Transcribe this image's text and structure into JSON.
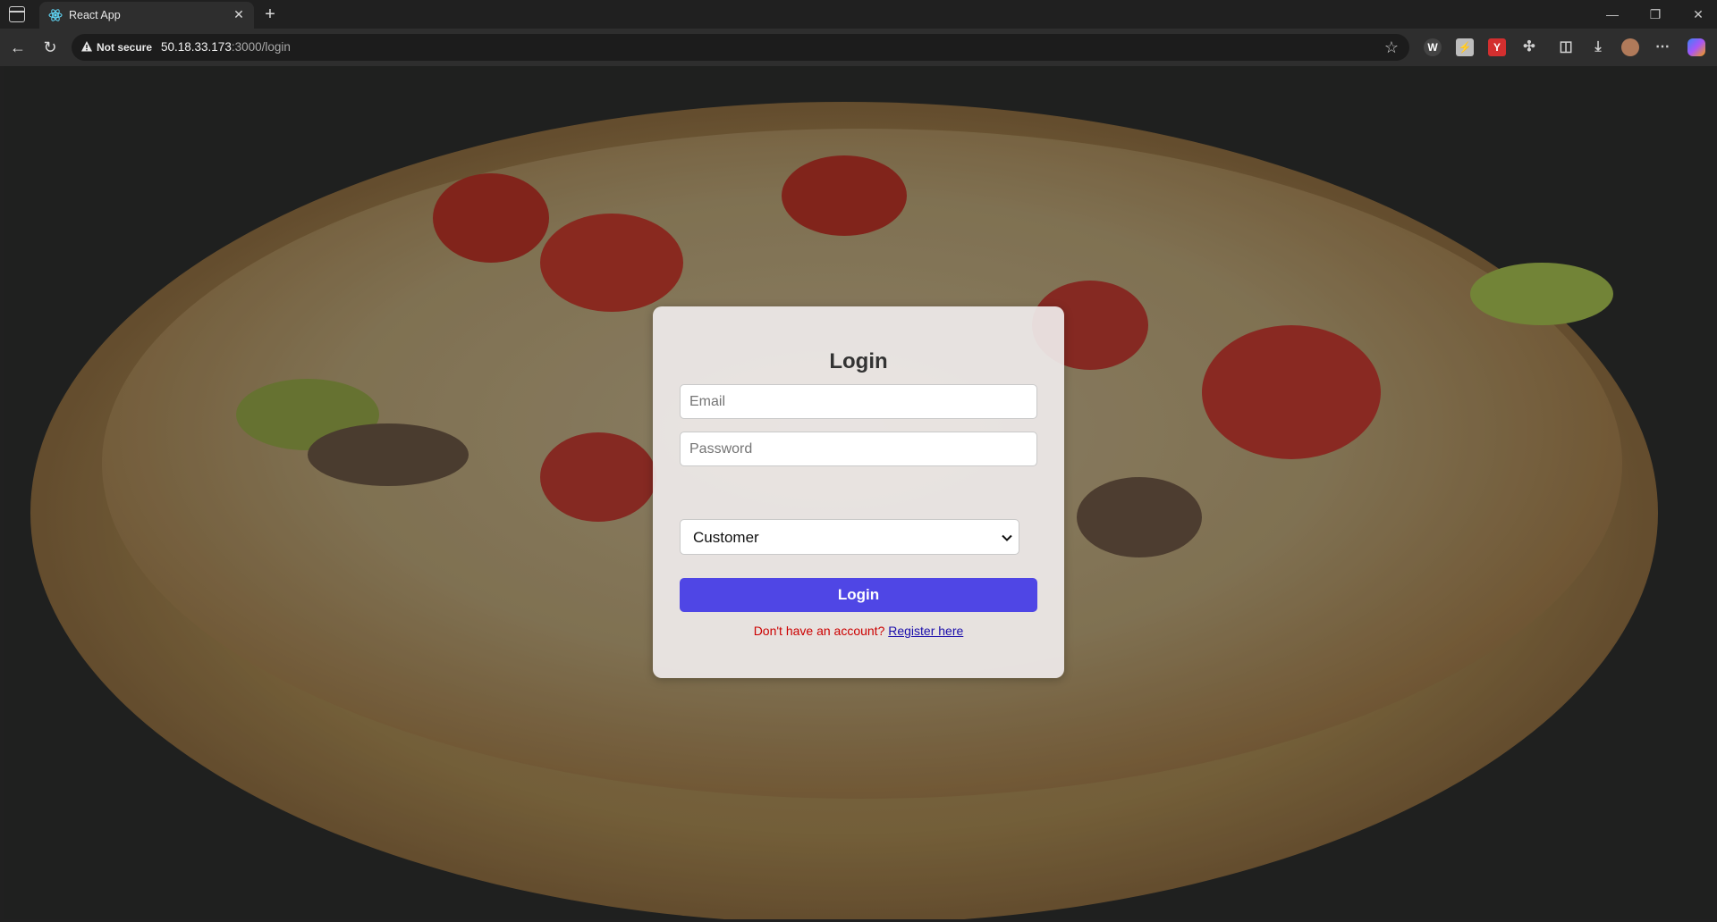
{
  "browser": {
    "tab_title": "React App",
    "security_label": "Not secure",
    "url_host": "50.18.33.173",
    "url_rest": ":3000/login",
    "extensions": [
      "W",
      "Y"
    ]
  },
  "login": {
    "title": "Login",
    "email_placeholder": "Email",
    "password_placeholder": "Password",
    "role_selected": "Customer",
    "submit_label": "Login",
    "register_prompt": "Don't have an account?",
    "register_link": "Register here"
  },
  "colors": {
    "primary_button": "#4f46e5",
    "prompt_text": "#cc0000",
    "link_text": "#1a0dab"
  }
}
